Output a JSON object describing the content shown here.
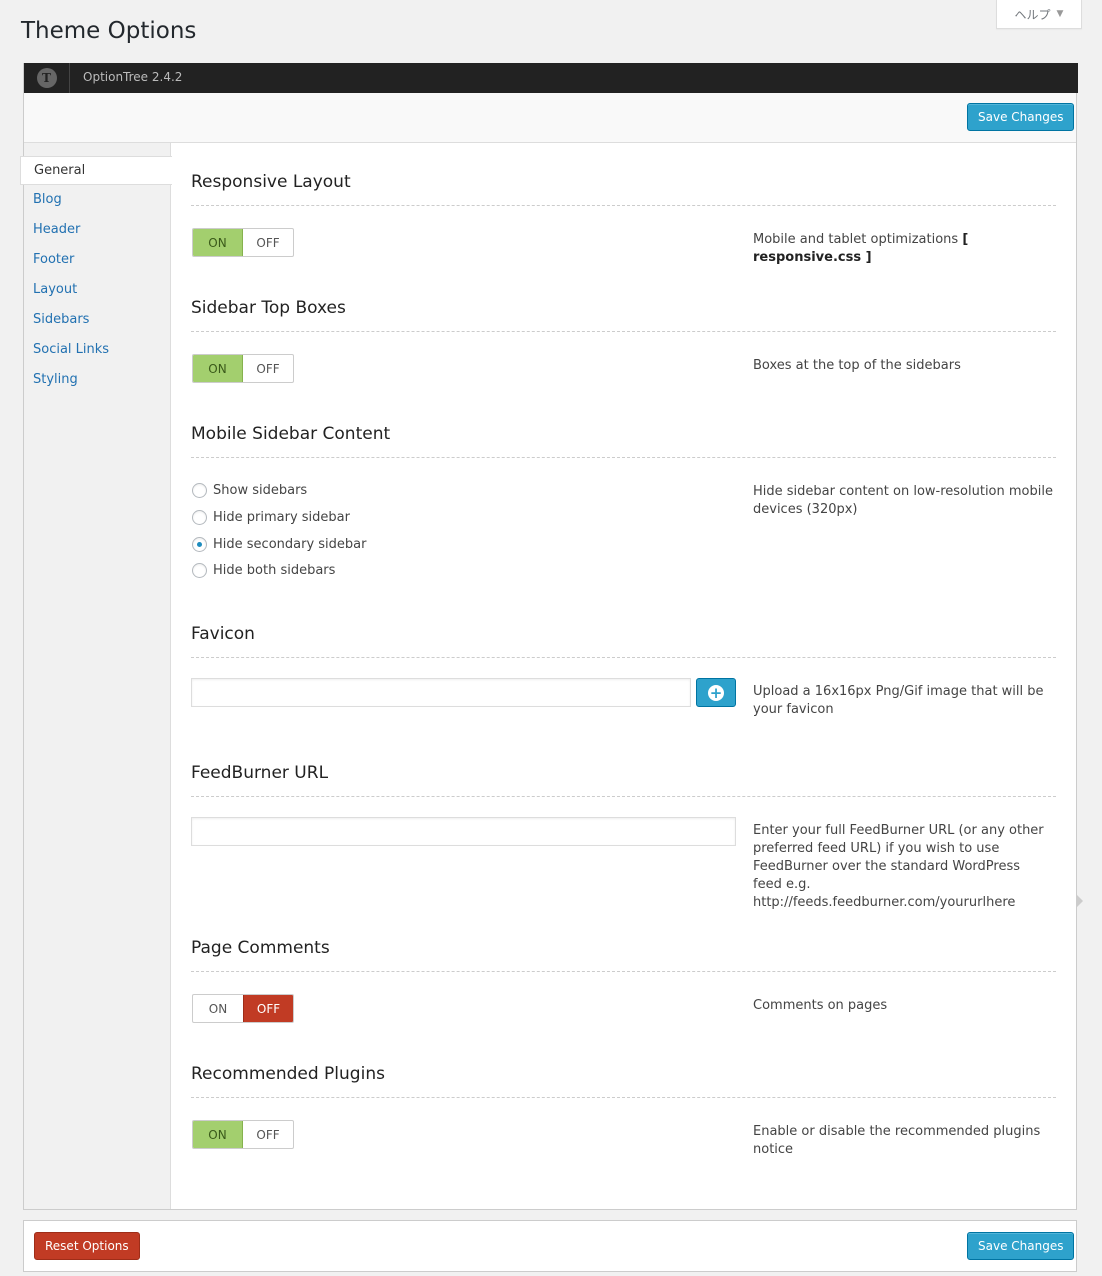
{
  "page": {
    "title": "Theme Options"
  },
  "help": {
    "label": "ヘルプ",
    "caret": "▼"
  },
  "header": {
    "logo_letter": "T",
    "version": "OptionTree 2.4.2"
  },
  "buttons": {
    "save_top": "Save Changes",
    "save_bottom": "Save Changes",
    "reset": "Reset Options"
  },
  "sidebar": {
    "items": [
      {
        "label": "General",
        "active": true
      },
      {
        "label": "Blog"
      },
      {
        "label": "Header"
      },
      {
        "label": "Footer"
      },
      {
        "label": "Layout"
      },
      {
        "label": "Sidebars"
      },
      {
        "label": "Social Links"
      },
      {
        "label": "Styling"
      }
    ]
  },
  "sections": {
    "responsive": {
      "title": "Responsive Layout",
      "on": "ON",
      "off": "OFF",
      "state": "on",
      "desc_prefix": "Mobile and tablet optimizations ",
      "desc_bracket_open": "[ ",
      "desc_bold": "responsive.css",
      "desc_bracket_close": " ]"
    },
    "sidebar_top": {
      "title": "Sidebar Top Boxes",
      "on": "ON",
      "off": "OFF",
      "state": "on",
      "desc": "Boxes at the top of the sidebars"
    },
    "mobile_sidebar": {
      "title": "Mobile Sidebar Content",
      "options": [
        "Show sidebars",
        "Hide primary sidebar",
        "Hide secondary sidebar",
        "Hide both sidebars"
      ],
      "selected": "Hide secondary sidebar",
      "desc": "Hide sidebar content on low-resolution mobile devices (320px)"
    },
    "favicon": {
      "title": "Favicon",
      "value": "",
      "desc": "Upload a 16x16px Png/Gif image that will be your favicon",
      "upload_icon": "plus-circle-icon"
    },
    "feedburner": {
      "title": "FeedBurner URL",
      "value": "",
      "desc": "Enter your full FeedBurner URL (or any other preferred feed URL) if you wish to use FeedBurner over the standard WordPress feed e.g. http://feeds.feedburner.com/yoururlhere"
    },
    "page_comments": {
      "title": "Page Comments",
      "on": "ON",
      "off": "OFF",
      "state": "off",
      "desc": "Comments on pages"
    },
    "recommended_plugins": {
      "title": "Recommended Plugins",
      "on": "ON",
      "off": "OFF",
      "state": "on",
      "desc": "Enable or disable the recommended plugins notice"
    }
  },
  "colors": {
    "primary": "#2ea2cc",
    "on": "#a3cf6e",
    "off": "#c13b24",
    "header_bg": "#222222"
  }
}
